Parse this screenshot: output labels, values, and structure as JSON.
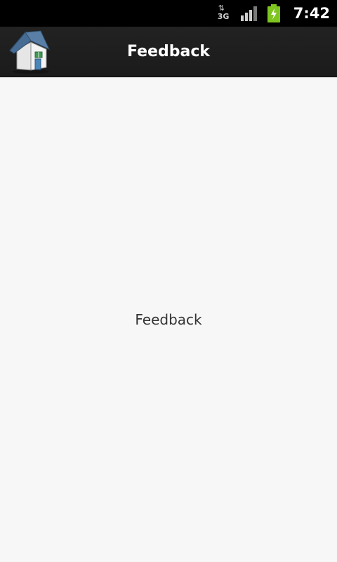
{
  "status_bar": {
    "network_type": "3G",
    "network_icon": "data-3g-icon",
    "signal_icon": "signal-strength-icon",
    "battery_icon": "battery-charging-icon",
    "time": "7:42"
  },
  "app_bar": {
    "home_icon": "home-icon",
    "title": "Feedback"
  },
  "content": {
    "label": "Feedback"
  },
  "colors": {
    "status_bar_bg": "#000000",
    "app_bar_bg": "#1e1e1e",
    "content_bg": "#f7f7f7",
    "battery_green": "#7ec51f",
    "title_text": "#ffffff",
    "body_text": "#333333"
  }
}
